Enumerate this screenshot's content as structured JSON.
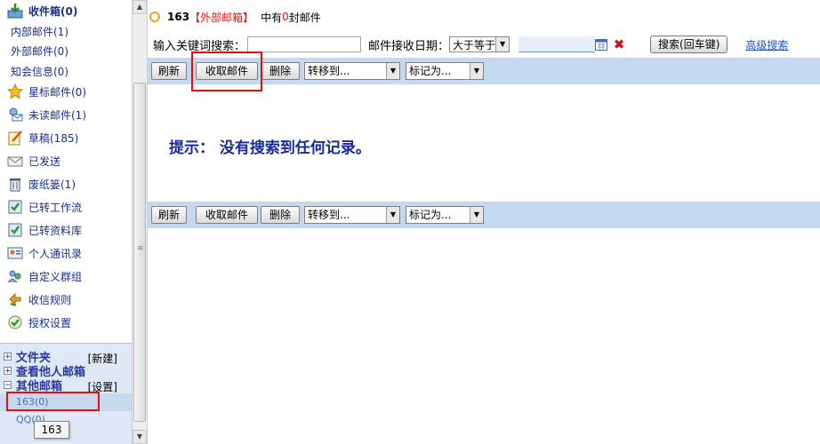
{
  "sidebar": {
    "inbox_label": "收件箱(0)",
    "sub_items": [
      "内部邮件(1)",
      "外部邮件(0)",
      "知会信息(0)"
    ],
    "nav_items": [
      {
        "label": "星标邮件(0)",
        "icon": "star-icon"
      },
      {
        "label": "未读邮件(1)",
        "icon": "unread-mail-icon"
      },
      {
        "label": "草稿(185)",
        "icon": "draft-icon"
      },
      {
        "label": "已发送",
        "icon": "sent-icon"
      },
      {
        "label": "废纸篓(1)",
        "icon": "trash-icon"
      },
      {
        "label": "已转工作流",
        "icon": "workflow-icon"
      },
      {
        "label": "已转资料库",
        "icon": "library-icon"
      },
      {
        "label": "个人通讯录",
        "icon": "contacts-icon"
      },
      {
        "label": "自定义群组",
        "icon": "group-icon"
      },
      {
        "label": "收信规则",
        "icon": "rules-icon"
      },
      {
        "label": "授权设置",
        "icon": "authorize-icon"
      }
    ],
    "tree": {
      "folders_label": "文件夹",
      "folders_action": "[新建]",
      "others_label": "查看他人邮箱",
      "external_label": "其他邮箱",
      "external_action": "[设置]",
      "folders_toggle": "+",
      "others_toggle": "+",
      "external_toggle": "−"
    },
    "accounts": [
      "163(0)",
      "QQ(0)"
    ],
    "tooltip": "163"
  },
  "header": {
    "account": "163",
    "account_type": "【外部邮箱】",
    "count_prefix": "中有",
    "count": "0",
    "count_suffix": "封邮件"
  },
  "search": {
    "keyword_label": "输入关键词搜索：",
    "keyword_value": "",
    "date_label": "邮件接收日期：",
    "date_op": "大于等于",
    "date_value": "",
    "search_button": "搜索(回车键)",
    "advanced_link": "高级搜索"
  },
  "toolbar": {
    "refresh": "刷新",
    "fetch": "收取邮件",
    "delete": "删除",
    "move_to": "转移到...",
    "mark_as": "标记为..."
  },
  "notice": "提示：  没有搜索到任何记录。",
  "colors": {
    "toolbar_bg": "#c4d8f0",
    "highlight": "#e01010",
    "nav_text": "#1b2f8a"
  }
}
